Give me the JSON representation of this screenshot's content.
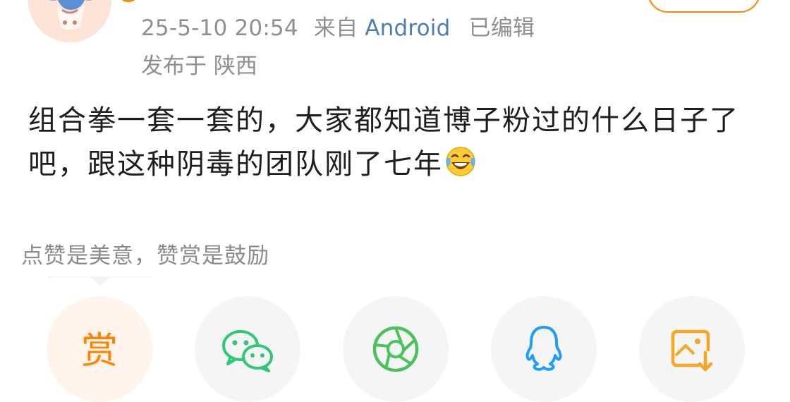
{
  "post": {
    "timestamp": "25-5-10 20:54",
    "source_prefix": "来自",
    "source": "Android",
    "edited": "已编辑",
    "location": "发布于 陕西",
    "text": "组合拳一套一套的，大家都知道博子粉过的什么日子了吧，跟这种阴毒的团队刚了七年",
    "emoji": "laughing-tears-emoji"
  },
  "reward_tip": "点赞是美意，赞赏是鼓励",
  "share": {
    "reward_label": "赏",
    "items": [
      "reward",
      "wechat",
      "moments",
      "qq",
      "save-image"
    ]
  },
  "colors": {
    "accent": "#ff8200",
    "source_link": "#507daf",
    "wechat": "#2fc877",
    "moments": "#49c25a",
    "qq": "#1e9dfa",
    "save_image": "#f5a623"
  }
}
